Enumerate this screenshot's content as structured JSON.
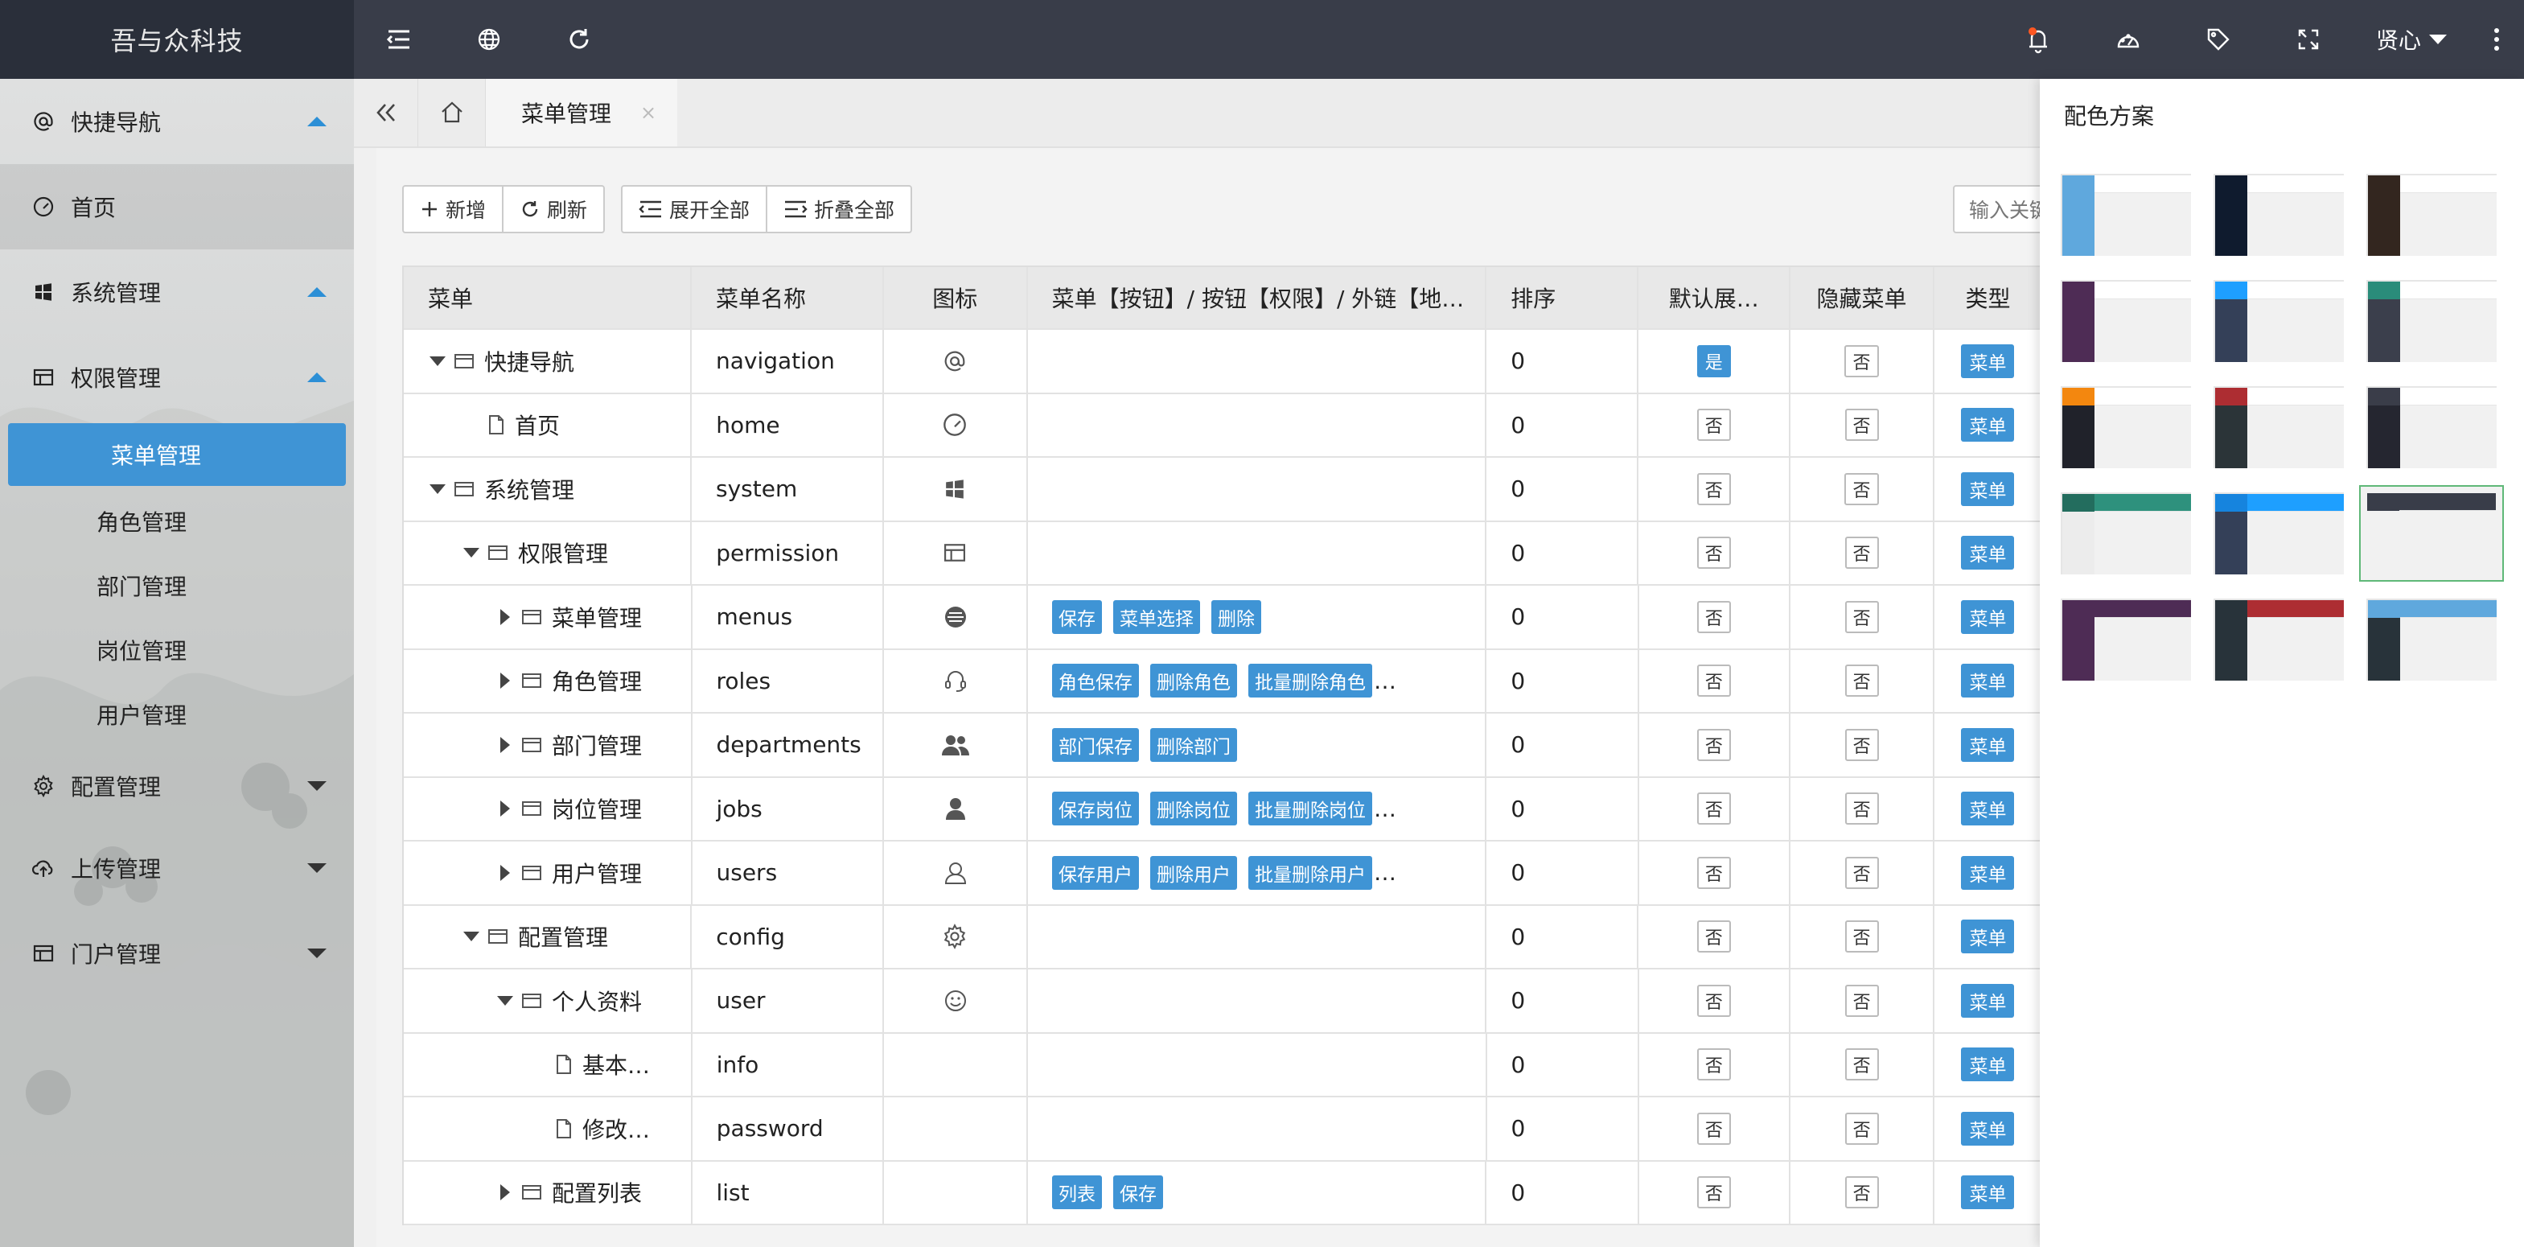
{
  "brand": {
    "logo_text": "吾与众科技"
  },
  "topbar": {
    "user_name": "贤心",
    "icons": [
      "hamburger-icon",
      "globe-icon",
      "refresh-icon",
      "bell-icon",
      "gauge-icon",
      "tag-icon",
      "fullscreen-icon",
      "more-icon"
    ]
  },
  "sidebar": {
    "items": [
      {
        "label": "快捷导航",
        "icon": "at-icon",
        "arrow": "up"
      },
      {
        "label": "首页",
        "icon": "dashboard-icon"
      },
      {
        "label": "系统管理",
        "icon": "windows-icon",
        "arrow": "up"
      },
      {
        "label": "权限管理",
        "icon": "browser-icon",
        "arrow": "up"
      },
      {
        "label": "配置管理",
        "icon": "gear-icon",
        "arrow": "down"
      },
      {
        "label": "上传管理",
        "icon": "cloud-upload-icon",
        "arrow": "down"
      },
      {
        "label": "门户管理",
        "icon": "browser-icon",
        "arrow": "down"
      }
    ],
    "sub_items": [
      "菜单管理",
      "角色管理",
      "部门管理",
      "岗位管理",
      "用户管理"
    ]
  },
  "tabs": {
    "active_label": "菜单管理",
    "close": "×"
  },
  "toolbar": {
    "add": "新增",
    "refresh": "刷新",
    "expand_all": "展开全部",
    "collapse_all": "折叠全部",
    "search_placeholder": "输入关键"
  },
  "table": {
    "headers": [
      "菜单",
      "菜单名称",
      "图标",
      "菜单【按钮】/ 按钮【权限】/ 外链【地…",
      "排序",
      "默认展…",
      "隐藏菜单",
      "类型"
    ],
    "rows": [
      {
        "label": "快捷导航",
        "name": "navigation",
        "icon": "at-icon",
        "tags": [],
        "sort": "0",
        "default": "是",
        "hidden": "否",
        "type": "菜单",
        "toggle": "down",
        "node": "folder",
        "indent": 0
      },
      {
        "label": "首页",
        "name": "home",
        "icon": "dashboard-icon",
        "tags": [],
        "sort": "0",
        "default": "否",
        "hidden": "否",
        "type": "菜单",
        "toggle": "none",
        "node": "file",
        "indent": 1
      },
      {
        "label": "系统管理",
        "name": "system",
        "icon": "windows-icon",
        "tags": [],
        "sort": "0",
        "default": "否",
        "hidden": "否",
        "type": "菜单",
        "toggle": "down",
        "node": "folder",
        "indent": 0
      },
      {
        "label": "权限管理",
        "name": "permission",
        "icon": "browser-icon",
        "tags": [],
        "sort": "0",
        "default": "否",
        "hidden": "否",
        "type": "菜单",
        "toggle": "down",
        "node": "folder",
        "indent": 1
      },
      {
        "label": "菜单管理",
        "name": "menus",
        "icon": "list-circle-icon",
        "tags": [
          "保存",
          "菜单选择",
          "删除"
        ],
        "more": false,
        "sort": "0",
        "default": "否",
        "hidden": "否",
        "type": "菜单",
        "toggle": "right",
        "node": "folder",
        "indent": 2
      },
      {
        "label": "角色管理",
        "name": "roles",
        "icon": "headset-icon",
        "tags": [
          "角色保存",
          "删除角色",
          "批量删除角色"
        ],
        "more": true,
        "sort": "0",
        "default": "否",
        "hidden": "否",
        "type": "菜单",
        "toggle": "right",
        "node": "folder",
        "indent": 2
      },
      {
        "label": "部门管理",
        "name": "departments",
        "icon": "users-icon",
        "tags": [
          "部门保存",
          "删除部门"
        ],
        "more": false,
        "sort": "0",
        "default": "否",
        "hidden": "否",
        "type": "菜单",
        "toggle": "right",
        "node": "folder",
        "indent": 2
      },
      {
        "label": "岗位管理",
        "name": "jobs",
        "icon": "user-icon",
        "tags": [
          "保存岗位",
          "删除岗位",
          "批量删除岗位"
        ],
        "more": true,
        "sort": "0",
        "default": "否",
        "hidden": "否",
        "type": "菜单",
        "toggle": "right",
        "node": "folder",
        "indent": 2
      },
      {
        "label": "用户管理",
        "name": "users",
        "icon": "user-outline-icon",
        "tags": [
          "保存用户",
          "删除用户",
          "批量删除用户"
        ],
        "more": true,
        "sort": "0",
        "default": "否",
        "hidden": "否",
        "type": "菜单",
        "toggle": "right",
        "node": "folder",
        "indent": 2
      },
      {
        "label": "配置管理",
        "name": "config",
        "icon": "gear-icon",
        "tags": [],
        "sort": "0",
        "default": "否",
        "hidden": "否",
        "type": "菜单",
        "toggle": "down",
        "node": "folder",
        "indent": 1
      },
      {
        "label": "个人资料",
        "name": "user",
        "icon": "smile-icon",
        "tags": [],
        "sort": "0",
        "default": "否",
        "hidden": "否",
        "type": "菜单",
        "toggle": "down",
        "node": "folder",
        "indent": 2
      },
      {
        "label": "基本…",
        "name": "info",
        "icon": "",
        "tags": [],
        "sort": "0",
        "default": "否",
        "hidden": "否",
        "type": "菜单",
        "toggle": "none",
        "node": "file",
        "indent": 3
      },
      {
        "label": "修改…",
        "name": "password",
        "icon": "",
        "tags": [],
        "sort": "0",
        "default": "否",
        "hidden": "否",
        "type": "菜单",
        "toggle": "none",
        "node": "file",
        "indent": 3
      },
      {
        "label": "配置列表",
        "name": "list",
        "icon": "",
        "tags": [
          "列表",
          "保存"
        ],
        "more": false,
        "sort": "0",
        "default": "否",
        "hidden": "否",
        "type": "菜单",
        "toggle": "right",
        "node": "folder",
        "indent": 2
      }
    ]
  },
  "theme_panel": {
    "title": "配色方案",
    "selected_index": 11,
    "schemes": [
      {
        "logo": "#5fa8dd",
        "side": "#5fa8dd",
        "top": "#ffffff"
      },
      {
        "logo": "#0f1b2e",
        "side": "#0f1b2e",
        "top": "#ffffff"
      },
      {
        "logo": "#33261f",
        "side": "#33261f",
        "top": "#ffffff"
      },
      {
        "logo": "#4e2c55",
        "side": "#4e2c55",
        "top": "#ffffff"
      },
      {
        "logo": "#1e9fff",
        "side": "#344058",
        "top": "#ffffff"
      },
      {
        "logo": "#2a8c7a",
        "side": "#3b3f4c",
        "top": "#ffffff"
      },
      {
        "logo": "#f3870f",
        "side": "#20222a",
        "top": "#ffffff"
      },
      {
        "logo": "#ad2d32",
        "side": "#2b3438",
        "top": "#ffffff"
      },
      {
        "logo": "#3a3d49",
        "side": "#252630",
        "top": "#ffffff"
      },
      {
        "logo": "#236d5e",
        "side": "#ececec",
        "top": "#2e917d"
      },
      {
        "logo": "#1684de",
        "side": "#344058",
        "top": "#1e9fff"
      },
      {
        "logo": "#393d49",
        "side": "#f1f1f1",
        "top": "#393d49"
      },
      {
        "logo": "#4e2c55",
        "side": "#4e2c55",
        "top": "#4e2c55"
      },
      {
        "logo": "#28333a",
        "side": "#28333a",
        "top": "#ad2d32"
      },
      {
        "logo": "#5fa8dd",
        "side": "#28333a",
        "top": "#5fa8dd"
      }
    ]
  }
}
